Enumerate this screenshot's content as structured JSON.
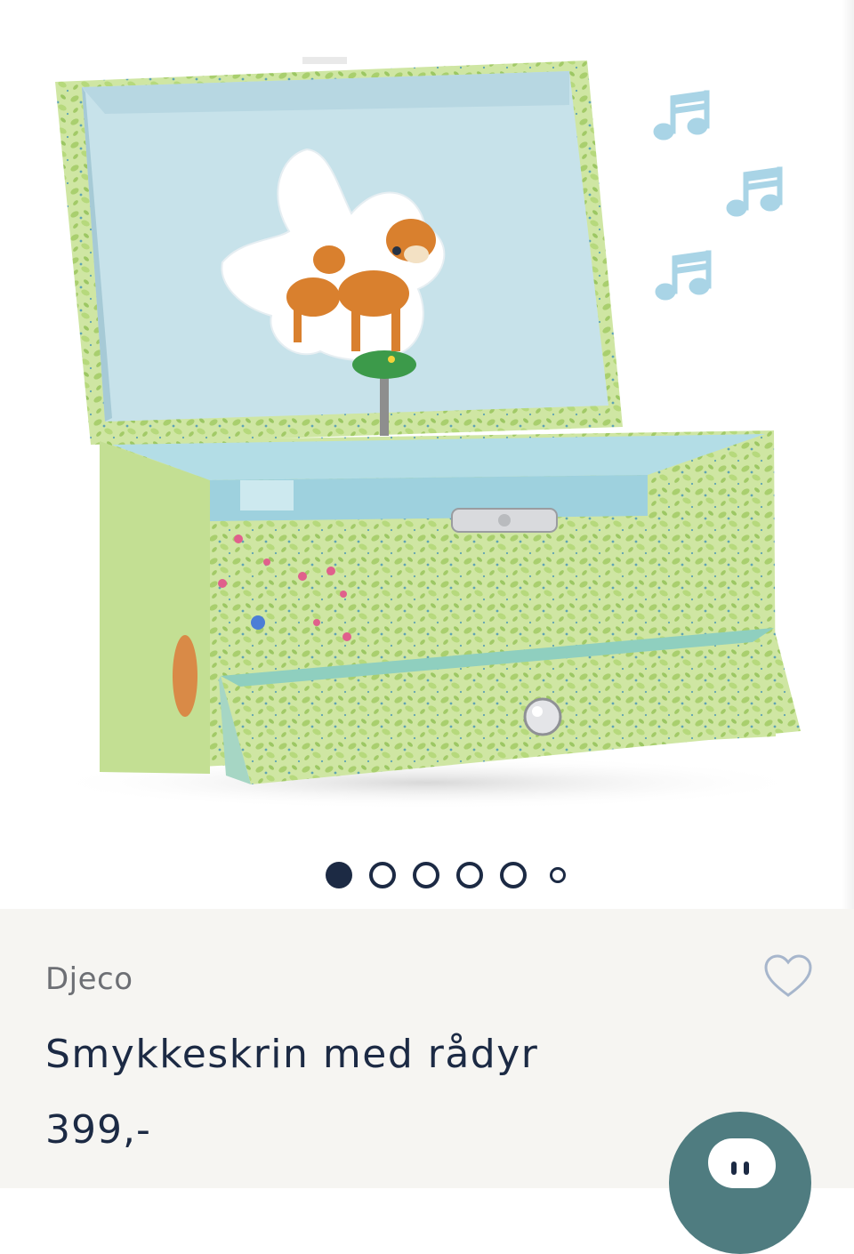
{
  "product": {
    "brand": "Djeco",
    "name": "Smykkeskrin med rådyr",
    "price": "399,-"
  },
  "gallery": {
    "image_count": 6,
    "active_index": 0,
    "image_subject": "music-box-with-deer"
  },
  "icons": {
    "favorite": "heart-outline-icon",
    "chat": "chat-bubble-icon",
    "music_notes": "music-note-icon"
  },
  "colors": {
    "text_primary": "#1c2a44",
    "text_secondary": "#6d6f74",
    "info_background": "#f6f5f2",
    "chat_button": "#4f7c80",
    "favorite_outline": "#a7b6cc"
  }
}
